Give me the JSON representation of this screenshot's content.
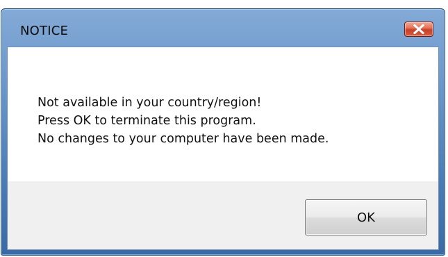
{
  "dialog": {
    "title": "NOTICE",
    "message_lines": [
      "Not available in your country/region!",
      "Press OK to terminate this program.",
      "No changes to your computer have been made."
    ],
    "ok_label": "OK",
    "close_icon": "close-x-icon"
  },
  "colors": {
    "title_bar": "#6b98cc",
    "close_button": "#c7412a",
    "content_background": "#ffffff",
    "button_area_background": "#f0f0f0"
  }
}
